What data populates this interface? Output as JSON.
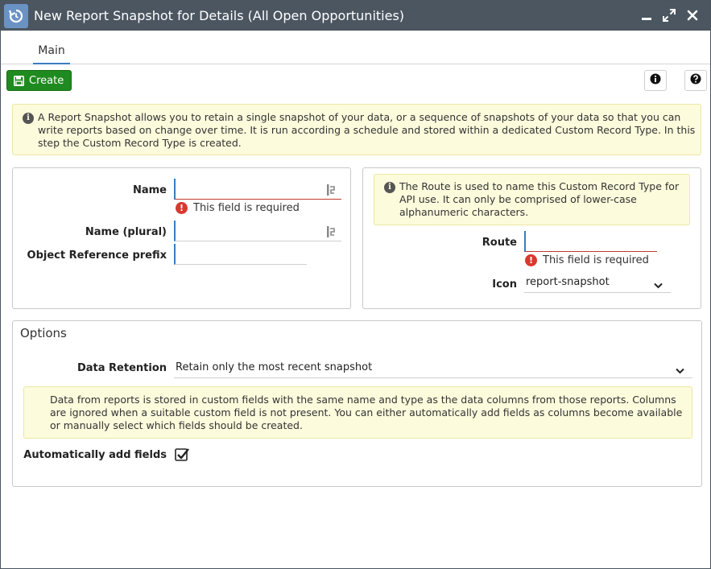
{
  "window": {
    "title": "New Report Snapshot for Details (All Open Opportunities)",
    "app_icon": "report-snapshot-icon",
    "controls": [
      "minimize-icon",
      "maximize-icon",
      "close-icon"
    ]
  },
  "tabs": [
    {
      "label": "Main",
      "active": true
    }
  ],
  "toolbar": {
    "create_label": "Create",
    "info_icon": "info-icon",
    "help_icon": "help-icon"
  },
  "intro_note": "A Report Snapshot allows you to retain a single snapshot of your data, or a sequence of snapshots of your data so that you can write reports based on change over time. It is run according a schedule and stored within a dedicated Custom Record Type. In this step the Custom Record Type is created.",
  "left_panel": {
    "name_label": "Name",
    "name_value": "",
    "name_error": "This field is required",
    "name_plural_label": "Name (plural)",
    "name_plural_value": "",
    "prefix_label": "Object Reference prefix",
    "prefix_value": ""
  },
  "right_panel": {
    "note": "The Route is used to name this Custom Record Type for API use. It can only be comprised of lower-case alphanumeric characters.",
    "route_label": "Route",
    "route_value": "",
    "route_error": "This field is required",
    "icon_label": "Icon",
    "icon_value": "report-snapshot"
  },
  "options": {
    "title": "Options",
    "retention_label": "Data Retention",
    "retention_value": "Retain only the most recent snapshot",
    "note": "Data from reports is stored in custom fields with the same name and type as the data columns from those reports. Columns are ignored when a suitable custom field is not present. You can either automatically add fields as columns become available or manually select which fields should be created.",
    "auto_add_label": "Automatically add fields",
    "auto_add_checked": true
  },
  "colors": {
    "titlebar": "#4b5661",
    "create_button": "#1f8a1f",
    "input_accent": "#3a7cbf",
    "error": "#d9382f",
    "note_background": "#fcfbdc"
  }
}
